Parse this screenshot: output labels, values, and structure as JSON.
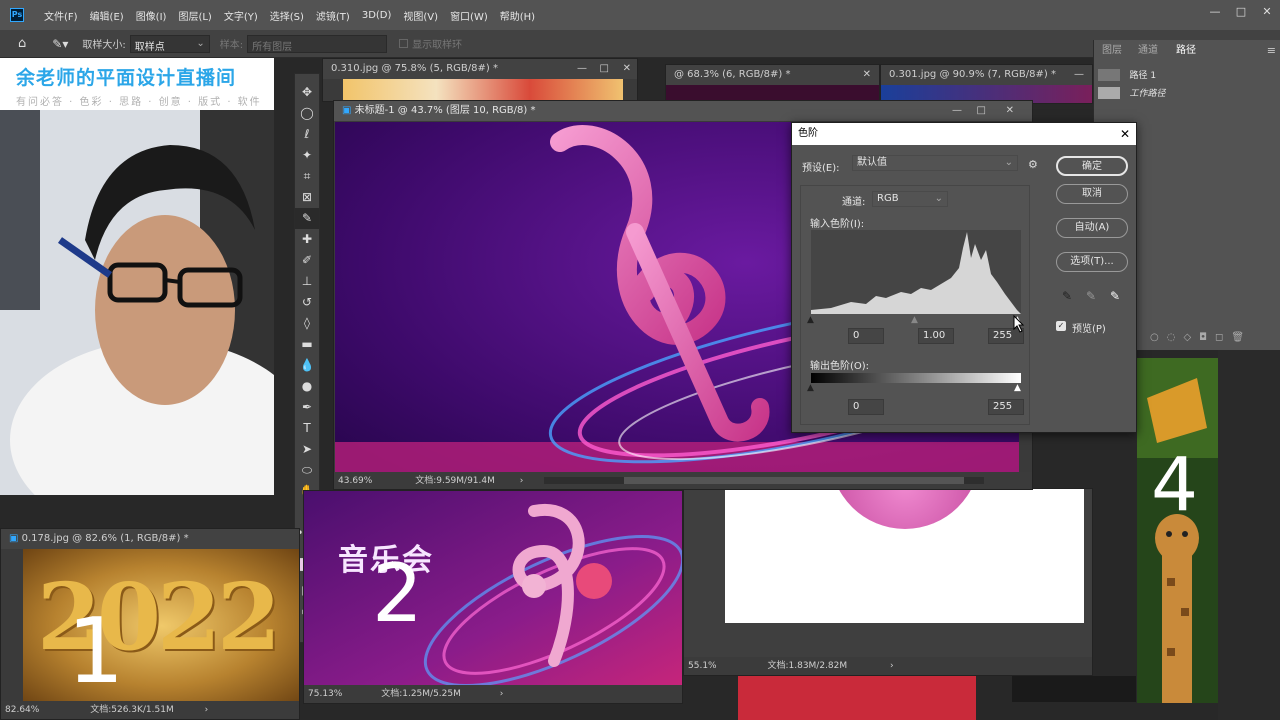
{
  "app": {
    "logo": "Ps",
    "menu": [
      "文件(F)",
      "编辑(E)",
      "图像(I)",
      "图层(L)",
      "文字(Y)",
      "选择(S)",
      "滤镜(T)",
      "3D(D)",
      "视图(V)",
      "窗口(W)",
      "帮助(H)"
    ],
    "window_controls": [
      "—",
      "□",
      "✕"
    ]
  },
  "options_bar": {
    "sample_size_label": "取样大小:",
    "sample_size_value": "取样点",
    "sample_label": "样本:",
    "sample_value": "所有图层",
    "show_ring_label": "显示取样环"
  },
  "webcam": {
    "title": "余老师的平面设计直播间",
    "subtitle": "有问必答 · 色彩 · 思路 · 创意 · 版式 · 软件"
  },
  "docs": {
    "main": {
      "title": "未标题-1 @ 43.7% (图层 10, RGB/8) *",
      "zoom": "43.69%",
      "info": "文档:9.59M/91.4M"
    },
    "doc_310": {
      "title": "0.310.jpg @ 75.8% (5, RGB/8#) *"
    },
    "doc_683": {
      "title": "@ 68.3% (6, RGB/8#) *"
    },
    "doc_301": {
      "title": "0.301.jpg @ 90.9% (7, RGB/8#) *"
    },
    "doc_178": {
      "title": "0.178.jpg @ 82.6% (1, RGB/8#) *",
      "zoom": "82.64%",
      "info": "文档:526.3K/1.51M",
      "big_text": "2022",
      "number": "1"
    },
    "doc_2": {
      "zoom": "75.13%",
      "info": "文档:1.25M/5.25M",
      "number": "2",
      "text": "音乐会"
    },
    "doc_3": {
      "zoom": "55.1%",
      "info": "文档:1.83M/2.82M"
    },
    "doc_4": {
      "number": "4"
    }
  },
  "levels": {
    "title": "色阶",
    "preset_label": "预设(E):",
    "preset_value": "默认值",
    "channel_label": "通道:",
    "channel_value": "RGB",
    "input_label": "输入色阶(I):",
    "input_black": "0",
    "input_gamma": "1.00",
    "input_white": "255",
    "output_label": "输出色阶(O):",
    "output_black": "0",
    "output_white": "255",
    "ok": "确定",
    "cancel": "取消",
    "auto": "自动(A)",
    "options": "选项(T)...",
    "preview": "预览(P)",
    "close": "✕"
  },
  "panel": {
    "tabs": [
      "图层",
      "通道",
      "路径"
    ],
    "active_tab": "路径",
    "items": [
      "路径 1",
      "工作路径"
    ]
  }
}
